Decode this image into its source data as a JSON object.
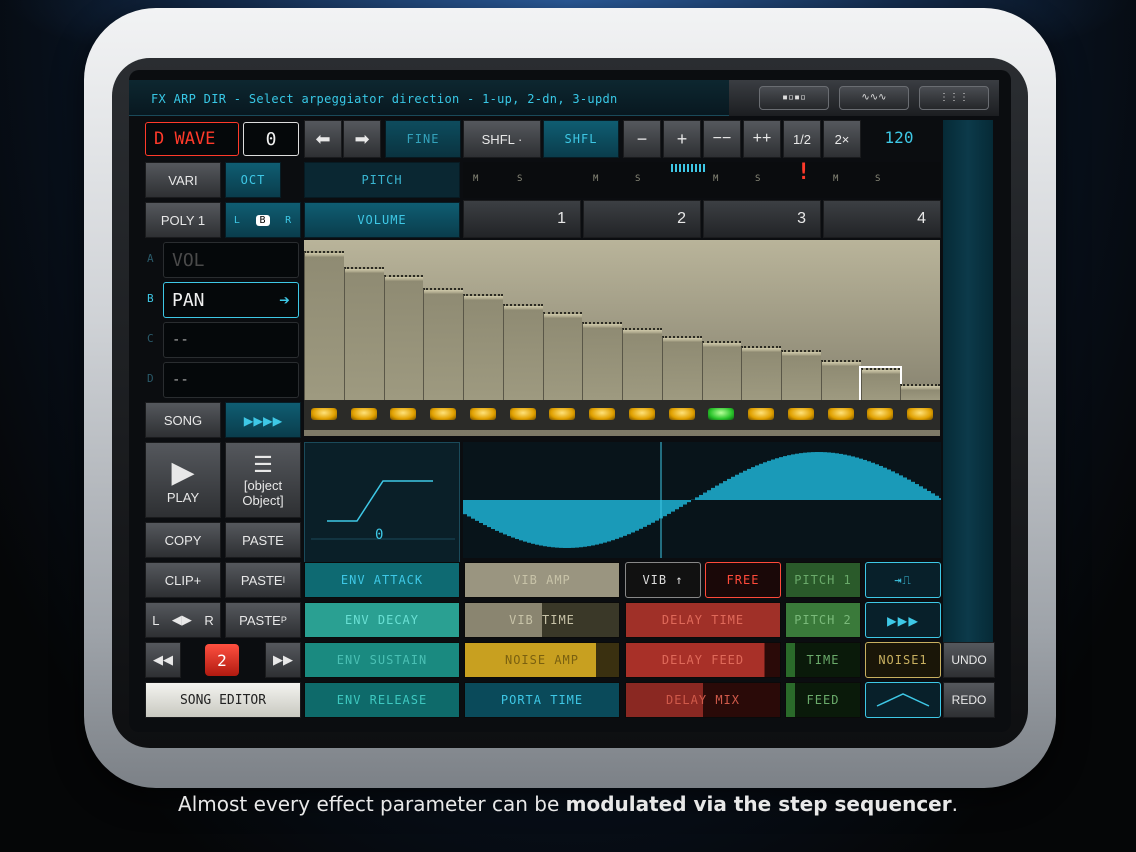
{
  "hint": "FX ARP DIR - Select arpeggiator direction - 1-up, 2-dn, 3-updn",
  "wave_label": "D WAVE",
  "wave_value": "0",
  "fine_label": "FINE",
  "shfl_btn": "SHFL ·",
  "shfl_label": "SHFL",
  "minus": "−",
  "plus": "+",
  "mm": "−−",
  "pp": "++",
  "half": "1/2",
  "double": "2×",
  "tempo": "120",
  "vari": "VARI",
  "oct": "OCT",
  "pitch": "PITCH",
  "poly": "POLY 1",
  "lr_l": "L",
  "lr_b": "B",
  "lr_r": "R",
  "volume": "VOLUME",
  "tracks": [
    "1",
    "2",
    "3",
    "4"
  ],
  "ms": [
    "M",
    "S",
    "M",
    "S",
    "M",
    "S",
    "M",
    "S"
  ],
  "slots": {
    "a": "A",
    "b": "B",
    "c": "C",
    "d": "D"
  },
  "vol": "VOL",
  "pan": "PAN",
  "empty1": "--",
  "empty2": "--",
  "song": "SONG",
  "play": "PLAY",
  "fx": {
    "env_attack": "ENV ATTACK",
    "vib_amp": "VIB AMP",
    "vib_up": "VIB ↑",
    "free": "FREE",
    "pitch1": "PITCH 1",
    "env_decay": "ENV DECAY",
    "vib_time": "VIB TIME",
    "delay_time": "DELAY TIME",
    "pitch2": "PITCH 2",
    "env_sustain": "ENV SUSTAIN",
    "noise_amp": "NOISE AMP",
    "delay_feed": "DELAY FEED",
    "time": "TIME",
    "noise1": "NOISE1",
    "env_release": "ENV RELEASE",
    "porta_time": "PORTA TIME",
    "delay_mix": "DELAY MIX",
    "feed": "FEED"
  },
  "copy": "COPY",
  "paste": "PASTE",
  "clip": "CLIP+",
  "paste_i": "PASTE",
  "paste_i_sub": "I",
  "paste_p": "PASTE",
  "paste_p_sub": "P",
  "lr2_l": "L",
  "lr2_r": "R",
  "pattern": "2",
  "song_editor": "SONG EDITOR",
  "curve_value": "0",
  "step_levels": [
    0.93,
    0.83,
    0.78,
    0.7,
    0.66,
    0.6,
    0.55,
    0.49,
    0.45,
    0.4,
    0.37,
    0.34,
    0.31,
    0.25,
    0.2,
    0.1,
    0.06
  ],
  "undo": "UNDO",
  "redo": "REDO",
  "caption_pre": "Almost every effect parameter can be ",
  "caption_bold": "modulated via the step sequencer",
  "caption_post": ".",
  "colors": {
    "teal": "#0f5d72",
    "accent": "#3ec8e6",
    "red": "#ff3a2a",
    "led": "#ffd24a"
  }
}
